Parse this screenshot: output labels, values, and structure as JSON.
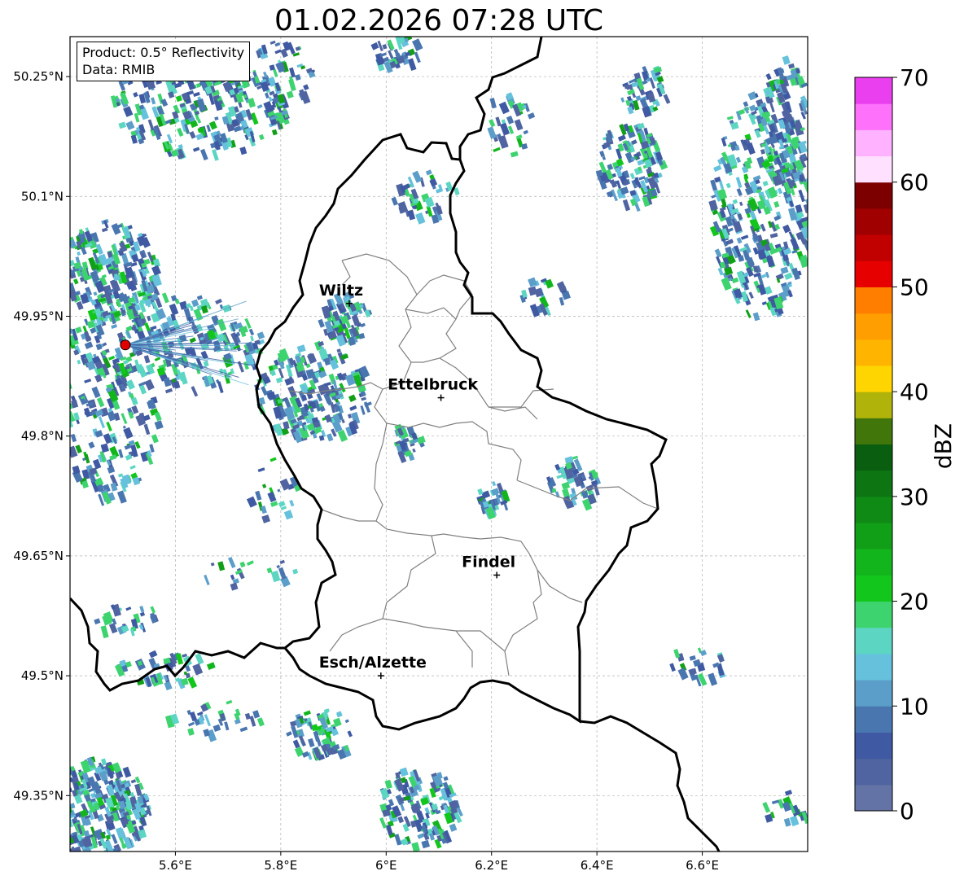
{
  "title": "01.02.2026 07:28 UTC",
  "info": {
    "product_line": "Product: 0.5° Reflectivity",
    "data_line": "Data: RMIB"
  },
  "axes": {
    "lon_ticks": [
      "5.6°E",
      "5.8°E",
      "6°E",
      "6.2°E",
      "6.4°E",
      "6.6°E"
    ],
    "lat_ticks": [
      "50.25°N",
      "50.1°N",
      "49.95°N",
      "49.8°N",
      "49.65°N",
      "49.5°N",
      "49.35°N"
    ],
    "lon_range": [
      5.4,
      6.8
    ],
    "lat_range": [
      49.28,
      50.3
    ]
  },
  "cities": [
    {
      "name": "Wiltz",
      "lon": 5.93,
      "lat": 49.966
    },
    {
      "name": "Ettelbruck",
      "lon": 6.104,
      "lat": 49.848
    },
    {
      "name": "Findel",
      "lon": 6.21,
      "lat": 49.626
    },
    {
      "name": "Esch/Alzette",
      "lon": 5.99,
      "lat": 49.5
    }
  ],
  "radar_site": {
    "lon": 5.505,
    "lat": 49.914,
    "color": "#e00000"
  },
  "colorbar": {
    "label": "dBZ",
    "ticks": [
      "0",
      "10",
      "20",
      "30",
      "40",
      "50",
      "60",
      "70"
    ],
    "colors": [
      "#6473a6",
      "#4f64a0",
      "#3f5aa2",
      "#4a76b0",
      "#5b9ec9",
      "#65c1dc",
      "#5cd6c3",
      "#3dd36f",
      "#12c61c",
      "#12b61c",
      "#129f18",
      "#0e8a15",
      "#0d7612",
      "#0a5e10",
      "#41760b",
      "#b0b40a",
      "#ffd500",
      "#ffb500",
      "#ff9e00",
      "#ff7e00",
      "#e60000",
      "#c10000",
      "#a00000",
      "#7c0000",
      "#ffe1ff",
      "#ffb2ff",
      "#fd71fb",
      "#e93fef"
    ]
  }
}
